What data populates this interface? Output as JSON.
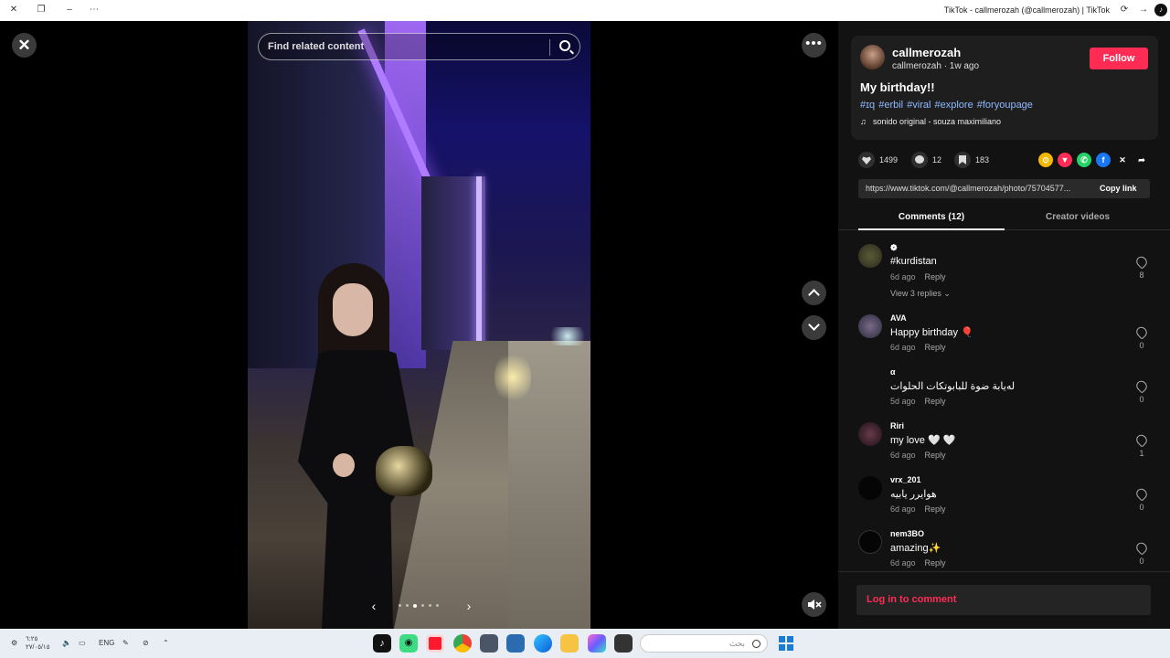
{
  "window": {
    "title": "TikTok - callmerozah (@callmerozah) | TikTok"
  },
  "viewer": {
    "search_placeholder": "Find related content",
    "carousel": {
      "total": 6,
      "active_index": 2
    }
  },
  "post": {
    "username": "callmerozah",
    "meta": "callmerozah · 1w ago",
    "follow_label": "Follow",
    "caption": "My birthday!!",
    "hashtags": "#ɪq #erbil #viral #explore #foryoupage",
    "music": "sonido original - souza maximiliano",
    "likes": "1499",
    "comments": "12",
    "saves": "183",
    "link": "https://www.tiktok.com/@callmerozah/photo/75704577...",
    "copy_link_label": "Copy link"
  },
  "tabs": {
    "comments": "Comments (12)",
    "creator": "Creator videos"
  },
  "comments": [
    {
      "user": "❁",
      "text": "#kurdistan",
      "time": "6d ago",
      "reply": "Reply",
      "likes": "8",
      "view_replies": "View 3 replies ⌄"
    },
    {
      "user": "AVA",
      "text": "Happy birthday 🎈",
      "time": "6d ago",
      "reply": "Reply",
      "likes": "0"
    },
    {
      "user": "α",
      "text": "لەیابة ضوة للبابوتکات الحلوات",
      "time": "5d ago",
      "reply": "Reply",
      "likes": "0"
    },
    {
      "user": "Riri",
      "text": "my love 🤍 🤍",
      "time": "6d ago",
      "reply": "Reply",
      "likes": "1"
    },
    {
      "user": "vrx_201",
      "text": "هوایرر یابیه",
      "time": "6d ago",
      "reply": "Reply",
      "likes": "0"
    },
    {
      "user": "nem3BO",
      "text": "amazing✨",
      "time": "6d ago",
      "reply": "Reply",
      "likes": "0"
    }
  ],
  "login_comment": "Log in to comment",
  "taskbar": {
    "clock_time": "٦:٢٥",
    "clock_date": "٢٧/٠٥/١٥",
    "lang": "ENG",
    "search_placeholder": "بحث"
  },
  "colors": {
    "accent": "#fe2c55",
    "hashtag": "#8fb8ff",
    "panel_bg": "#121212"
  }
}
